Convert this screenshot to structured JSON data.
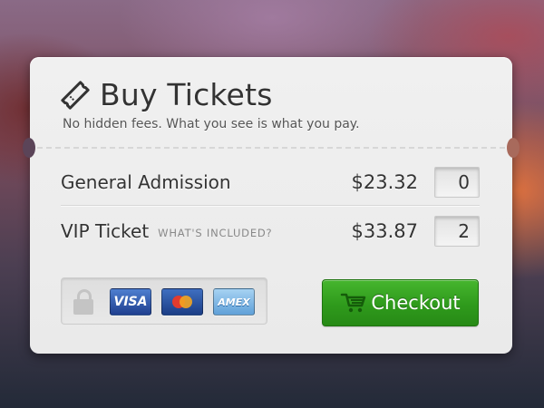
{
  "widget": {
    "title": "Buy Tickets",
    "subtitle": "No hidden fees. What you see is what you pay.",
    "title_icon": "ticket-icon"
  },
  "tickets": [
    {
      "name": "General Admission",
      "price": "$23.32",
      "quantity": "0",
      "extra_link": ""
    },
    {
      "name": "VIP Ticket",
      "price": "$33.87",
      "quantity": "2",
      "extra_link": "WHAT'S INCLUDED?"
    }
  ],
  "payment": {
    "icons": [
      "lock-icon",
      "visa-card-icon",
      "mastercard-icon",
      "amex-card-icon"
    ],
    "visa_text": "VISA",
    "amex_text": "AMEX"
  },
  "checkout": {
    "label": "Checkout",
    "icon": "cart-icon",
    "color": "#2f9a1c"
  }
}
